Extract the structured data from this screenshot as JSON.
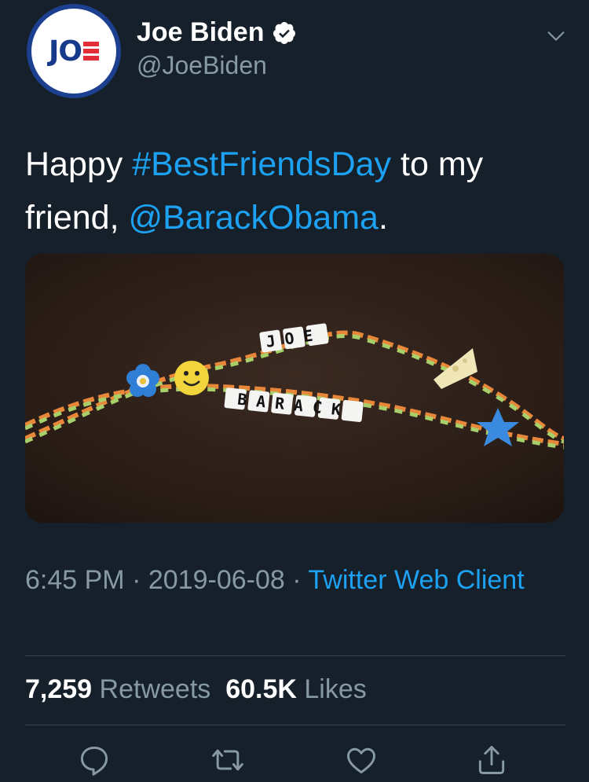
{
  "author": {
    "display_name": "Joe Biden",
    "handle": "@JoeBiden",
    "avatar_text": "JO",
    "verified": true
  },
  "tweet": {
    "text_before": "Happy ",
    "hashtag": "#BestFriendsDay",
    "text_middle": " to my friend, ",
    "mention": "@BarackObama",
    "text_after": "."
  },
  "media": {
    "bead_word_top": "JOE",
    "bead_word_bottom": "BARACK"
  },
  "meta": {
    "time": "6:45 PM",
    "separator": "·",
    "date": "2019-06-08",
    "source": "Twitter Web Client"
  },
  "stats": {
    "retweets_count": "7,259",
    "retweets_label": "Retweets",
    "likes_count": "60.5K",
    "likes_label": "Likes"
  },
  "icons": {
    "menu": "chevron-down-icon",
    "verified": "verified-badge-icon",
    "reply": "reply-icon",
    "retweet": "retweet-icon",
    "like": "heart-icon",
    "share": "share-icon"
  },
  "colors": {
    "background": "#15202b",
    "link": "#1da1f2",
    "secondary_text": "#8899a6",
    "divider": "#38444d"
  }
}
